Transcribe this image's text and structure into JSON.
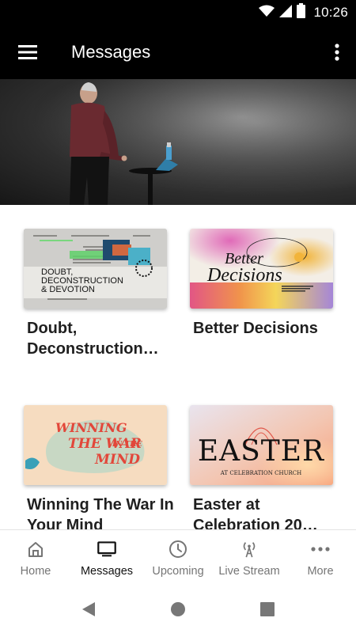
{
  "status_bar": {
    "time": "10:26"
  },
  "app_bar": {
    "title": "Messages",
    "menu_icon": "menu-icon",
    "overflow_icon": "more-vert-icon"
  },
  "hero": {
    "alt": "Speaker on stage"
  },
  "cards": [
    {
      "title": "Doubt, Deconstruction…",
      "thumb_text_1": "DOUBT,",
      "thumb_text_2": "DECONSTRUCTION",
      "thumb_text_3": "& DEVOTION"
    },
    {
      "title": "Better Decisions",
      "thumb_text_1": "Better",
      "thumb_text_2": "Decisions"
    },
    {
      "title": "Winning The War In Your Mind",
      "thumb_text_1": "WINNING",
      "thumb_text_2": "THE WAR",
      "thumb_text_3": "IN THE",
      "thumb_text_4": "MIND"
    },
    {
      "title": "Easter at Celebration 20…",
      "thumb_text_1": "EASTER",
      "thumb_text_2": "AT CELEBRATION CHURCH"
    }
  ],
  "bottom_nav": {
    "items": [
      {
        "label": "Home",
        "icon": "home-icon",
        "active": false
      },
      {
        "label": "Messages",
        "icon": "tv-icon",
        "active": true
      },
      {
        "label": "Upcoming",
        "icon": "clock-icon",
        "active": false
      },
      {
        "label": "Live Stream",
        "icon": "broadcast-icon",
        "active": false
      },
      {
        "label": "More",
        "icon": "more-horiz-icon",
        "active": false
      }
    ]
  },
  "colors": {
    "app_bar": "#000000",
    "active_nav": "#111111",
    "inactive_nav": "#757575"
  }
}
